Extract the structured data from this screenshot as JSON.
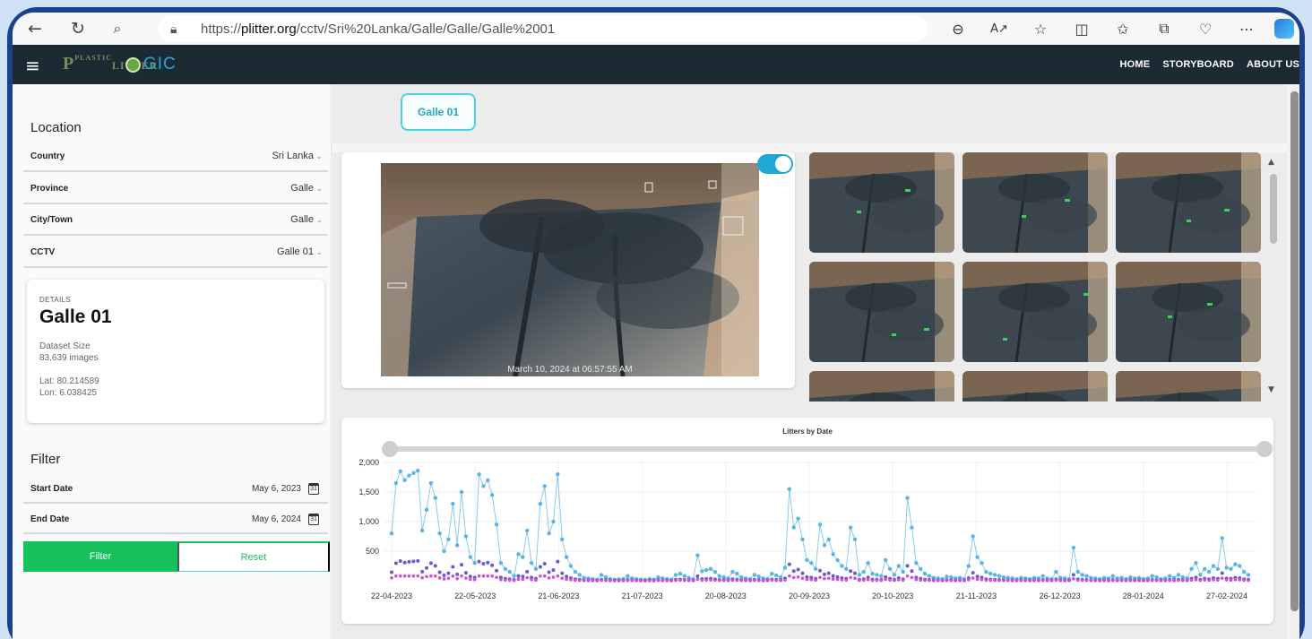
{
  "browser": {
    "url_prefix": "https://",
    "url_host": "plitter.org",
    "url_path": "/cctv/Sri%20Lanka/Galle/Galle/Galle%2001"
  },
  "app": {
    "logo_text": "LITTER",
    "logo_small": "PLASTIC",
    "logo_gic": "GIC",
    "nav": [
      "HOME",
      "STORYBOARD",
      "ABOUT US"
    ]
  },
  "sidebar": {
    "location_title": "Location",
    "selectors": [
      {
        "label": "Country",
        "value": "Sri Lanka"
      },
      {
        "label": "Province",
        "value": "Galle"
      },
      {
        "label": "City/Town",
        "value": "Galle"
      },
      {
        "label": "CCTV",
        "value": "Galle 01"
      }
    ],
    "details": {
      "label": "DETAILS",
      "name": "Galle 01",
      "dataset_label": "Dataset Size",
      "dataset_value": "83,639 images",
      "lat": "Lat: 80.214589",
      "lon": "Lon: 6.038425"
    },
    "filter_title": "Filter",
    "start_label": "Start Date",
    "start_value": "May 6, 2023",
    "end_label": "End Date",
    "end_value": "May 6, 2024",
    "filter_button": "Filter",
    "reset_button": "Reset"
  },
  "main": {
    "cctv_tab": "Galle 01",
    "cam_timestamp": "March 10, 2024 at 06:57:55 AM"
  },
  "colors": {
    "accent_green": "#16c25c",
    "accent_cyan": "#4cd4dc",
    "navbar": "#1b2a33",
    "series_total": "#5ab4e5",
    "series_b": "#6a5acd",
    "series_c": "#d14fd6"
  },
  "chart_data": {
    "type": "line",
    "title": "Litters by Date",
    "xlabel": "",
    "ylabel": "",
    "ylim": [
      0,
      2000
    ],
    "yticks": [
      "2,000",
      "1,500",
      "1,000",
      "500"
    ],
    "x_tick_labels": [
      "22-04-2023",
      "22-05-2023",
      "21-06-2023",
      "21-07-2023",
      "20-08-2023",
      "20-09-2023",
      "20-10-2023",
      "21-11-2023",
      "26-12-2023",
      "28-01-2024",
      "27-02-2024"
    ],
    "series": [
      {
        "color": "#5ab4e5",
        "values": [
          800,
          1650,
          1850,
          1700,
          1780,
          1820,
          1860,
          850,
          1200,
          1650,
          1400,
          800,
          500,
          700,
          1300,
          600,
          1500,
          750,
          400,
          300,
          1800,
          1600,
          1700,
          1450,
          950,
          300,
          200,
          150,
          80,
          450,
          400,
          850,
          300,
          200,
          1300,
          1600,
          800,
          1000,
          1800,
          700,
          400,
          250,
          150,
          100,
          50,
          40,
          30,
          20,
          100,
          60,
          30,
          20,
          25,
          30,
          80,
          40,
          30,
          20,
          15,
          30,
          20,
          60,
          40,
          30,
          20,
          100,
          120,
          80,
          50,
          30,
          430,
          160,
          180,
          200,
          150,
          80,
          60,
          40,
          150,
          120,
          60,
          40,
          30,
          100,
          70,
          40,
          30,
          120,
          90,
          60,
          220,
          1550,
          900,
          1050,
          700,
          350,
          300,
          200,
          950,
          600,
          700,
          450,
          350,
          250,
          200,
          900,
          700,
          100,
          150,
          300,
          120,
          100,
          80,
          350,
          200,
          100,
          250,
          150,
          1400,
          900,
          300,
          200,
          120,
          80,
          50,
          40,
          30,
          70,
          60,
          40,
          50,
          30,
          250,
          750,
          400,
          300,
          150,
          120,
          100,
          80,
          60,
          50,
          40,
          30,
          50,
          40,
          30,
          50,
          40,
          80,
          40,
          30,
          150,
          50,
          40,
          30,
          560,
          150,
          100,
          80,
          50,
          40,
          30,
          50,
          40,
          80,
          40,
          50,
          30,
          60,
          40,
          50,
          30,
          40,
          80,
          60,
          30,
          40,
          80,
          50,
          100,
          60,
          40,
          200,
          300,
          100,
          200,
          150,
          250,
          200,
          720,
          220,
          200,
          280,
          250,
          150,
          100
        ]
      }
    ]
  }
}
